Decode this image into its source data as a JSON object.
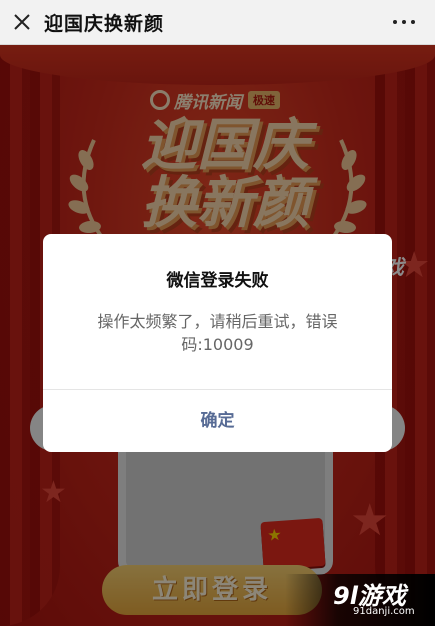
{
  "nav": {
    "title": "迎国庆换新颜",
    "close_icon": "close-icon",
    "more_icon": "more-dots-icon"
  },
  "page": {
    "brand_name": "腾讯新闻",
    "brand_badge": "极速",
    "hero_title_line1": "迎国庆",
    "hero_title_line2": "换新颜",
    "login_button": "立即登录"
  },
  "dialog": {
    "title": "微信登录失败",
    "message": "操作太频繁了，请稍后重试，错误码:10009",
    "confirm_label": "确定"
  },
  "watermark": {
    "top_brand": "91游戏",
    "top_url": "91danji.com",
    "bottom_brand": "9l游戏",
    "bottom_url": "91danji.com"
  },
  "colors": {
    "accent_link": "#576b95",
    "page_red": "#c8281b"
  }
}
